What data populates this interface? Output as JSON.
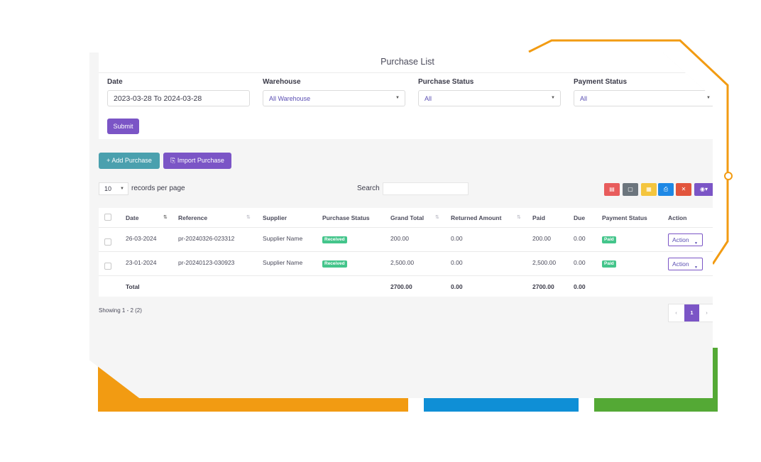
{
  "page": {
    "title": "Purchase List"
  },
  "filters": {
    "date": {
      "label": "Date",
      "value": "2023-03-28 To 2024-03-28"
    },
    "warehouse": {
      "label": "Warehouse",
      "value": "All Warehouse"
    },
    "purchase_status": {
      "label": "Purchase Status",
      "value": "All"
    },
    "payment_status": {
      "label": "Payment Status",
      "value": "All"
    },
    "submit_label": "Submit"
  },
  "actions": {
    "add_purchase": "+ Add Purchase",
    "import_purchase": "Import Purchase"
  },
  "table_controls": {
    "page_length": "10",
    "records_per_page": "records per page",
    "search_label": "Search",
    "search_value": ""
  },
  "toolbar_icons": [
    "pdf-icon",
    "csv-icon",
    "excel-icon",
    "print-icon",
    "delete-icon",
    "column-visibility-icon"
  ],
  "colors": {
    "accent": "#7b55c6",
    "add_button": "#4aa0ae",
    "badge_green": "#44c58b",
    "pdf": "#e85c5c",
    "csv": "#6c757d",
    "excel": "#f4c53e",
    "print": "#1e88e5",
    "delete": "#e2553d"
  },
  "table": {
    "columns": [
      "Date",
      "Reference",
      "Supplier",
      "Purchase Status",
      "Grand Total",
      "Returned Amount",
      "Paid",
      "Due",
      "Payment Status",
      "Action"
    ],
    "rows": [
      {
        "date": "26-03-2024",
        "reference": "pr-20240326-023312",
        "supplier": "Supplier Name",
        "purchase_status": "Received",
        "grand_total": "200.00",
        "returned_amount": "0.00",
        "paid": "200.00",
        "due": "0.00",
        "payment_status": "Paid",
        "action": "Action"
      },
      {
        "date": "23-01-2024",
        "reference": "pr-20240123-030923",
        "supplier": "Supplier Name",
        "purchase_status": "Received",
        "grand_total": "2,500.00",
        "returned_amount": "0.00",
        "paid": "2,500.00",
        "due": "0.00",
        "payment_status": "Paid",
        "action": "Action"
      }
    ],
    "totals": {
      "label": "Total",
      "grand_total": "2700.00",
      "returned_amount": "0.00",
      "paid": "2700.00",
      "due": "0.00"
    }
  },
  "pagination": {
    "showing": "Showing 1 - 2 (2)",
    "prev": "‹",
    "current": "1",
    "next": "›"
  }
}
